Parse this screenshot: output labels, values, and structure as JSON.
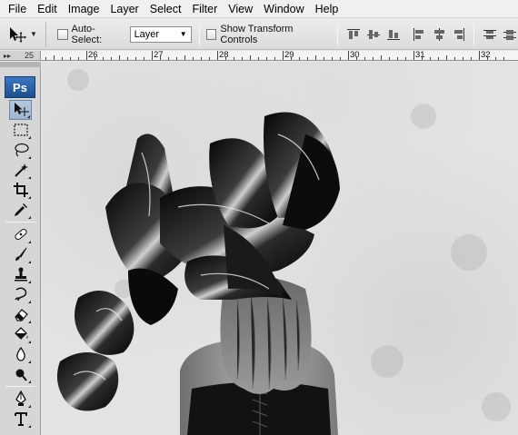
{
  "menubar": {
    "items": [
      "File",
      "Edit",
      "Image",
      "Layer",
      "Select",
      "Filter",
      "View",
      "Window",
      "Help"
    ]
  },
  "options": {
    "tool_icon": "move-tool-icon",
    "auto_select_label": "Auto-Select:",
    "auto_select_value": "Layer",
    "show_transform_label": "Show Transform Controls",
    "align_icons": [
      "align-top-edges-icon",
      "align-vertical-centers-icon",
      "align-bottom-edges-icon",
      "align-left-edges-icon",
      "align-horizontal-centers-icon",
      "align-right-edges-icon",
      "distribute-top-icon",
      "distribute-vertical-centers-icon"
    ]
  },
  "ruler": {
    "corner_label": "25",
    "numbers": [
      "26",
      "27",
      "28",
      "29",
      "30",
      "31",
      "32"
    ]
  },
  "toolbox": {
    "logo": "Ps",
    "tools": [
      "move-tool-icon",
      "marquee-tool-icon",
      "lasso-tool-icon",
      "magic-wand-tool-icon",
      "crop-tool-icon",
      "eyedropper-tool-icon",
      "healing-brush-tool-icon",
      "brush-tool-icon",
      "clone-stamp-tool-icon",
      "history-brush-tool-icon",
      "eraser-tool-icon",
      "paint-bucket-tool-icon",
      "blur-tool-icon",
      "dodge-tool-icon",
      "pen-tool-icon",
      "type-tool-icon"
    ],
    "active_tool": "move-tool-icon"
  },
  "canvas": {
    "description_colors": {
      "background": "#e3e3e3",
      "subject": "#111111"
    }
  }
}
